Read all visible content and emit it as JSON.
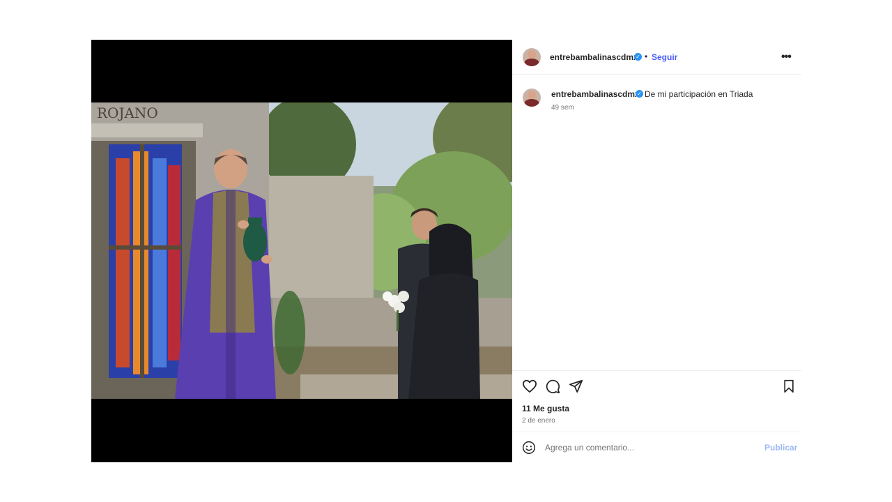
{
  "post": {
    "image_alt": "Escena de cementerio: sacerdote con urna junto a una cripta, pareja de luto con flores blancas",
    "crypt_inscription": "ROJANO"
  },
  "header": {
    "username": "entrebambalinascdmx",
    "separator": "•",
    "follow_label": "Seguir",
    "more_label": "•••"
  },
  "caption": {
    "username": "entrebambalinascdmx",
    "text": "De mi participación en Triada",
    "time_ago": "49 sem"
  },
  "actions": {
    "icons": [
      "heart-icon",
      "comment-icon",
      "share-icon",
      "bookmark-icon"
    ]
  },
  "stats": {
    "likes": "11 Me gusta",
    "date": "2 de enero"
  },
  "comment": {
    "placeholder": "Agrega un comentario...",
    "publish_label": "Publicar"
  },
  "colors": {
    "accent": "#4a5cff",
    "verified": "#2a93f5",
    "publish_disabled": "#9db8f7",
    "muted": "#737373"
  }
}
